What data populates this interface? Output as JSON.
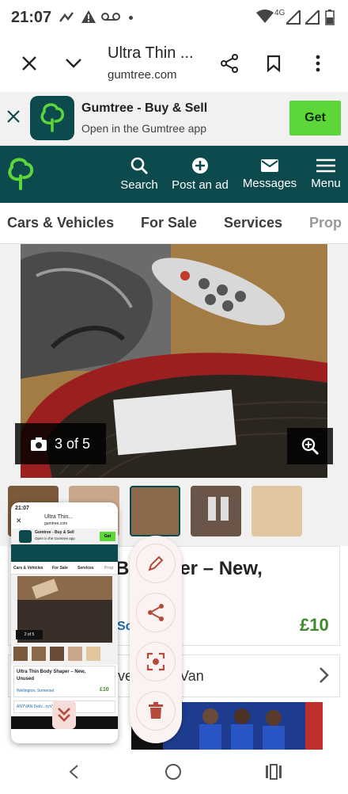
{
  "status_bar": {
    "time": "21:07",
    "network": "4G"
  },
  "custom_tab": {
    "title": "Ultra Thin ...",
    "url": "gumtree.com"
  },
  "app_banner": {
    "name": "Gumtree - Buy & Sell",
    "subtitle": "Open in the Gumtree app",
    "get_label": "Get"
  },
  "nav": {
    "search": "Search",
    "post_ad": "Post an ad",
    "messages": "Messages",
    "menu": "Menu"
  },
  "categories": [
    "Cars & Vehicles",
    "For Sale",
    "Services",
    "Prop"
  ],
  "gallery": {
    "counter": "3 of 5"
  },
  "listing": {
    "title_fragment": "Bo   haper – New,",
    "price": "£10",
    "location_fragment": "So"
  },
  "anyvan": {
    "text": "ve     ith AnyVan"
  },
  "preview": {
    "time": "21:07",
    "title": "Ultra Thin...",
    "url": "gumtree.com",
    "app_name": "Gumtree - Buy & Sell",
    "app_sub": "Open in the Gumtree app",
    "get": "Get",
    "cats": [
      "Cars & Vehicles",
      "For Sale",
      "Services",
      "Prop"
    ],
    "counter": "2 of 5",
    "listing_title_line1": "Ultra Thin Body Shaper – New,",
    "listing_title_line2": "Unused",
    "location": "Wellington, Somerset",
    "price": "£10",
    "anyvan": "ANYVAN  Deliv...nyVan"
  },
  "colors": {
    "brand_teal": "#0d4a4e",
    "brand_green": "#5cd639",
    "price_green": "#3f8a2a",
    "fab_bg": "#fbf3f1",
    "fab_icon": "#b54a3a"
  }
}
